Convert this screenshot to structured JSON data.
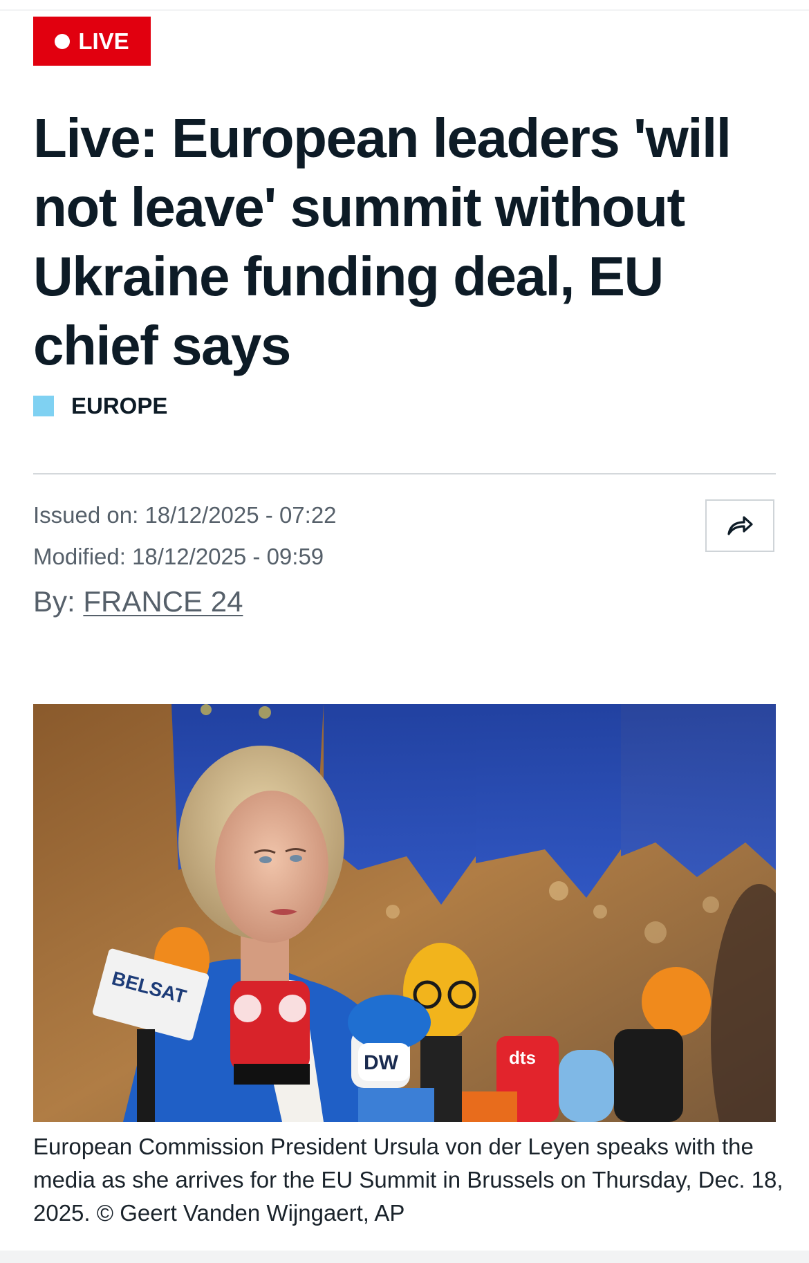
{
  "live_badge": {
    "label": "LIVE"
  },
  "article": {
    "headline": "Live: European leaders 'will not leave' summit without Ukraine funding deal, EU chief says",
    "category": "EUROPE",
    "issued_label": "Issued on:",
    "issued_value": "18/12/2025 - 07:22",
    "modified_label": "Modified:",
    "modified_value": "18/12/2025 - 09:59",
    "by_label": "By:",
    "author": "FRANCE 24",
    "share_icon": "share-arrow-icon"
  },
  "photo": {
    "mic_labels": [
      "BELSAT",
      "DW",
      "dts"
    ],
    "caption": "European Commission President Ursula von der Leyen speaks with the media as she arrives for the EU Summit in Brussels on Thursday, Dec. 18, 2025. © Geert Vanden Wijngaert, AP"
  },
  "colors": {
    "live_red": "#e1000f",
    "category_blue": "#7fd1f2",
    "headline": "#0d1b26",
    "meta_gray": "#56606a"
  }
}
